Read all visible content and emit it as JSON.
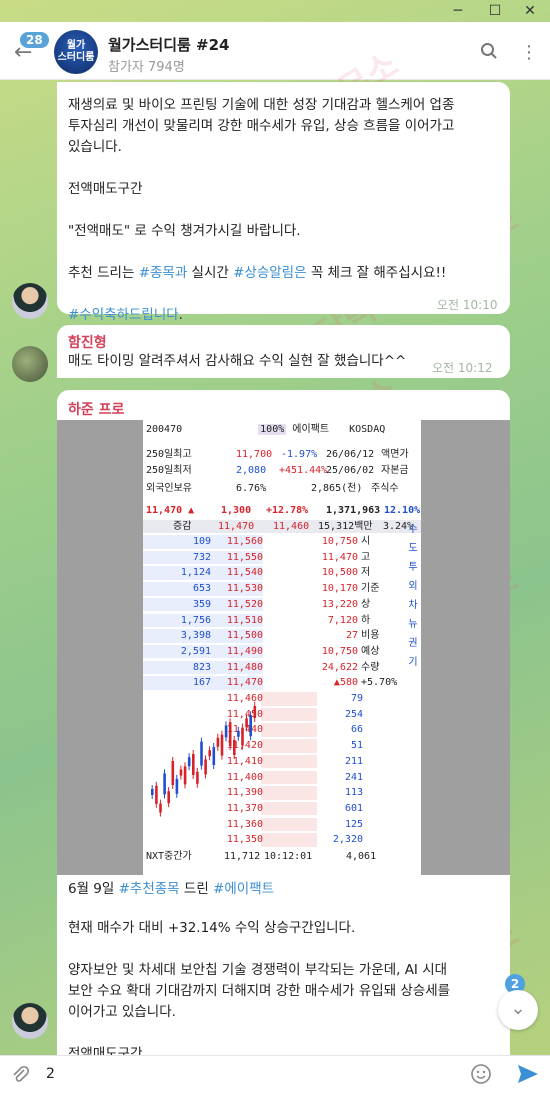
{
  "window": {
    "minimize": "─",
    "maximize": "☐",
    "close": "✕"
  },
  "header": {
    "unread_badge": "28",
    "channel_avatar_text": "월가\n스터디룸",
    "title": "월가스터디룸 #24",
    "subtitle": "참가자 794명"
  },
  "messages": [
    {
      "text": "재생의료 및 바이오 프린팅 기술에 대한 성장 기대감과 헬스케어 업종\n투자심리 개선이 맞물리며 강한 매수세가 유입, 상승 흐름을 이어가고\n있습니다.\n\n전액매도구간\n\n\"전액매도\" 로 수익 챙겨가시길 바랍니다.\n\n추천 드리는 ",
      "hash1": "#종목과",
      "mid": " 실시간 ",
      "hash2": "#상승알림은",
      "tail": " 꼭 체크 잘 해주십시요!!",
      "hash3": "#수익축하드립니다",
      "tail3": ".",
      "time": "오전 10:10"
    },
    {
      "sender": "함진형",
      "text": "매도 타이밍 알려주셔서 감사해요 수익 실현 잘 했습니다^^",
      "time": "오전 10:12"
    },
    {
      "sender": "하준 프로",
      "caption_pre": "6월 9일 ",
      "hash1": "#추천종목",
      "caption_mid": " 드린 ",
      "hash2": "#에이팩트",
      "body": "현재 매수가 대비 +32.14% 수익 상승구간입니다.\n\n양자보안 및 차세대 보안칩 기술 경쟁력이 부각되는 가운데, AI 시대\n보안 수요 확대 기대감까지 더해지며 강한 매수세가 유입돼 상승세를\n이어가고 있습니다.\n\n전액매도구간"
    }
  ],
  "stock": {
    "code": "200470",
    "pct_box": "100%",
    "name": "에이팩트",
    "market": "KOSDAQ",
    "row1": [
      "250일최고",
      "11,700",
      "-1.97%",
      "26/06/12",
      "액면가"
    ],
    "row2": [
      "250일최저",
      "2,080",
      "+451.44%",
      "25/06/02",
      "자본금"
    ],
    "row3": [
      "외국인보유",
      "6.76%",
      "2,865(천)",
      "주식수"
    ],
    "price_row": [
      "11,470",
      "▲",
      "1,300",
      "+12.78%",
      "1,371,963",
      "12.10%"
    ],
    "head_row": [
      "증감",
      "11,470",
      "11,460",
      "15,312백만",
      "3.24%"
    ],
    "asks": [
      [
        "109",
        "11,560",
        "10,750",
        "시"
      ],
      [
        "732",
        "11,550",
        "11,470",
        "고"
      ],
      [
        "1,124",
        "11,540",
        "10,500",
        "저"
      ],
      [
        "653",
        "11,530",
        "10,170",
        "기준"
      ],
      [
        "359",
        "11,520",
        "13,220",
        "상"
      ],
      [
        "1,756",
        "11,510",
        "7,120",
        "하"
      ],
      [
        "3,398",
        "11,500",
        "27",
        "비용"
      ],
      [
        "2,591",
        "11,490",
        "10,750",
        "예상"
      ],
      [
        "823",
        "11,480",
        "24,622",
        "수량"
      ],
      [
        "167",
        "11,470",
        "▲580",
        "+5.70%"
      ]
    ],
    "bids": [
      [
        "11,460",
        "79"
      ],
      [
        "11,450",
        "254"
      ],
      [
        "11,440",
        "66"
      ],
      [
        "11,420",
        "51"
      ],
      [
        "11,410",
        "211"
      ],
      [
        "11,400",
        "241"
      ],
      [
        "11,390",
        "113"
      ],
      [
        "11,370",
        "601"
      ],
      [
        "11,360",
        "125"
      ],
      [
        "11,350",
        "2,320"
      ]
    ],
    "side_tabs": [
      "수",
      "도",
      "투",
      "외",
      "차",
      "뉴",
      "권",
      "기"
    ],
    "footer": [
      "NXT중간가",
      "11,712",
      "10:12:01",
      "4,061"
    ]
  },
  "input": {
    "value": "2"
  },
  "scroll": {
    "badge": "2"
  },
  "watermark": "담덕 법률사무소"
}
